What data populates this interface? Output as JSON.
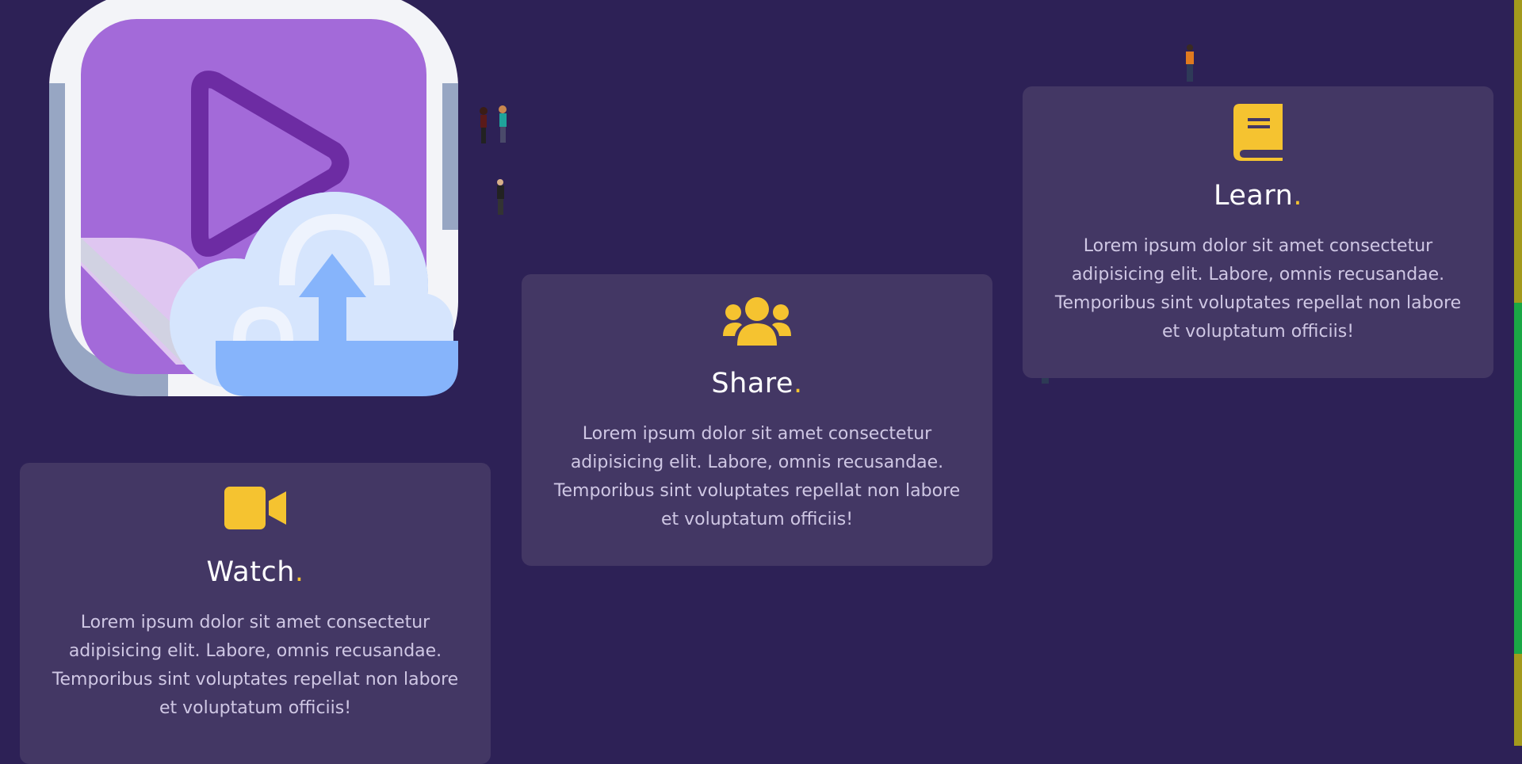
{
  "cards": [
    {
      "id": "learn",
      "title": "Learn",
      "dot": ".",
      "text": "Lorem ipsum dolor sit amet consectetur adipisicing elit. Labore, omnis recusandae. Temporibus sint voluptates repellat non labore et voluptatum officiis!",
      "icon": "book-icon"
    },
    {
      "id": "share",
      "title": "Share",
      "dot": ".",
      "text": "Lorem ipsum dolor sit amet consectetur adipisicing elit. Labore, omnis recusandae. Temporibus sint voluptates repellat non labore et voluptatum officiis!",
      "icon": "users-icon"
    },
    {
      "id": "watch",
      "title": "Watch",
      "dot": ".",
      "text": "Lorem ipsum dolor sit amet consectetur adipisicing elit. Labore, omnis recusandae. Temporibus sint voluptates repellat non labore et voluptatum officiis!",
      "icon": "video-camera-icon"
    }
  ],
  "hero": {
    "icon": "video-upload-icon"
  },
  "colors": {
    "background": "#2d2156",
    "card": "#433764",
    "accent": "#f5c330",
    "hero_purple": "#a36ad9",
    "hero_blue": "#86b4fb"
  }
}
